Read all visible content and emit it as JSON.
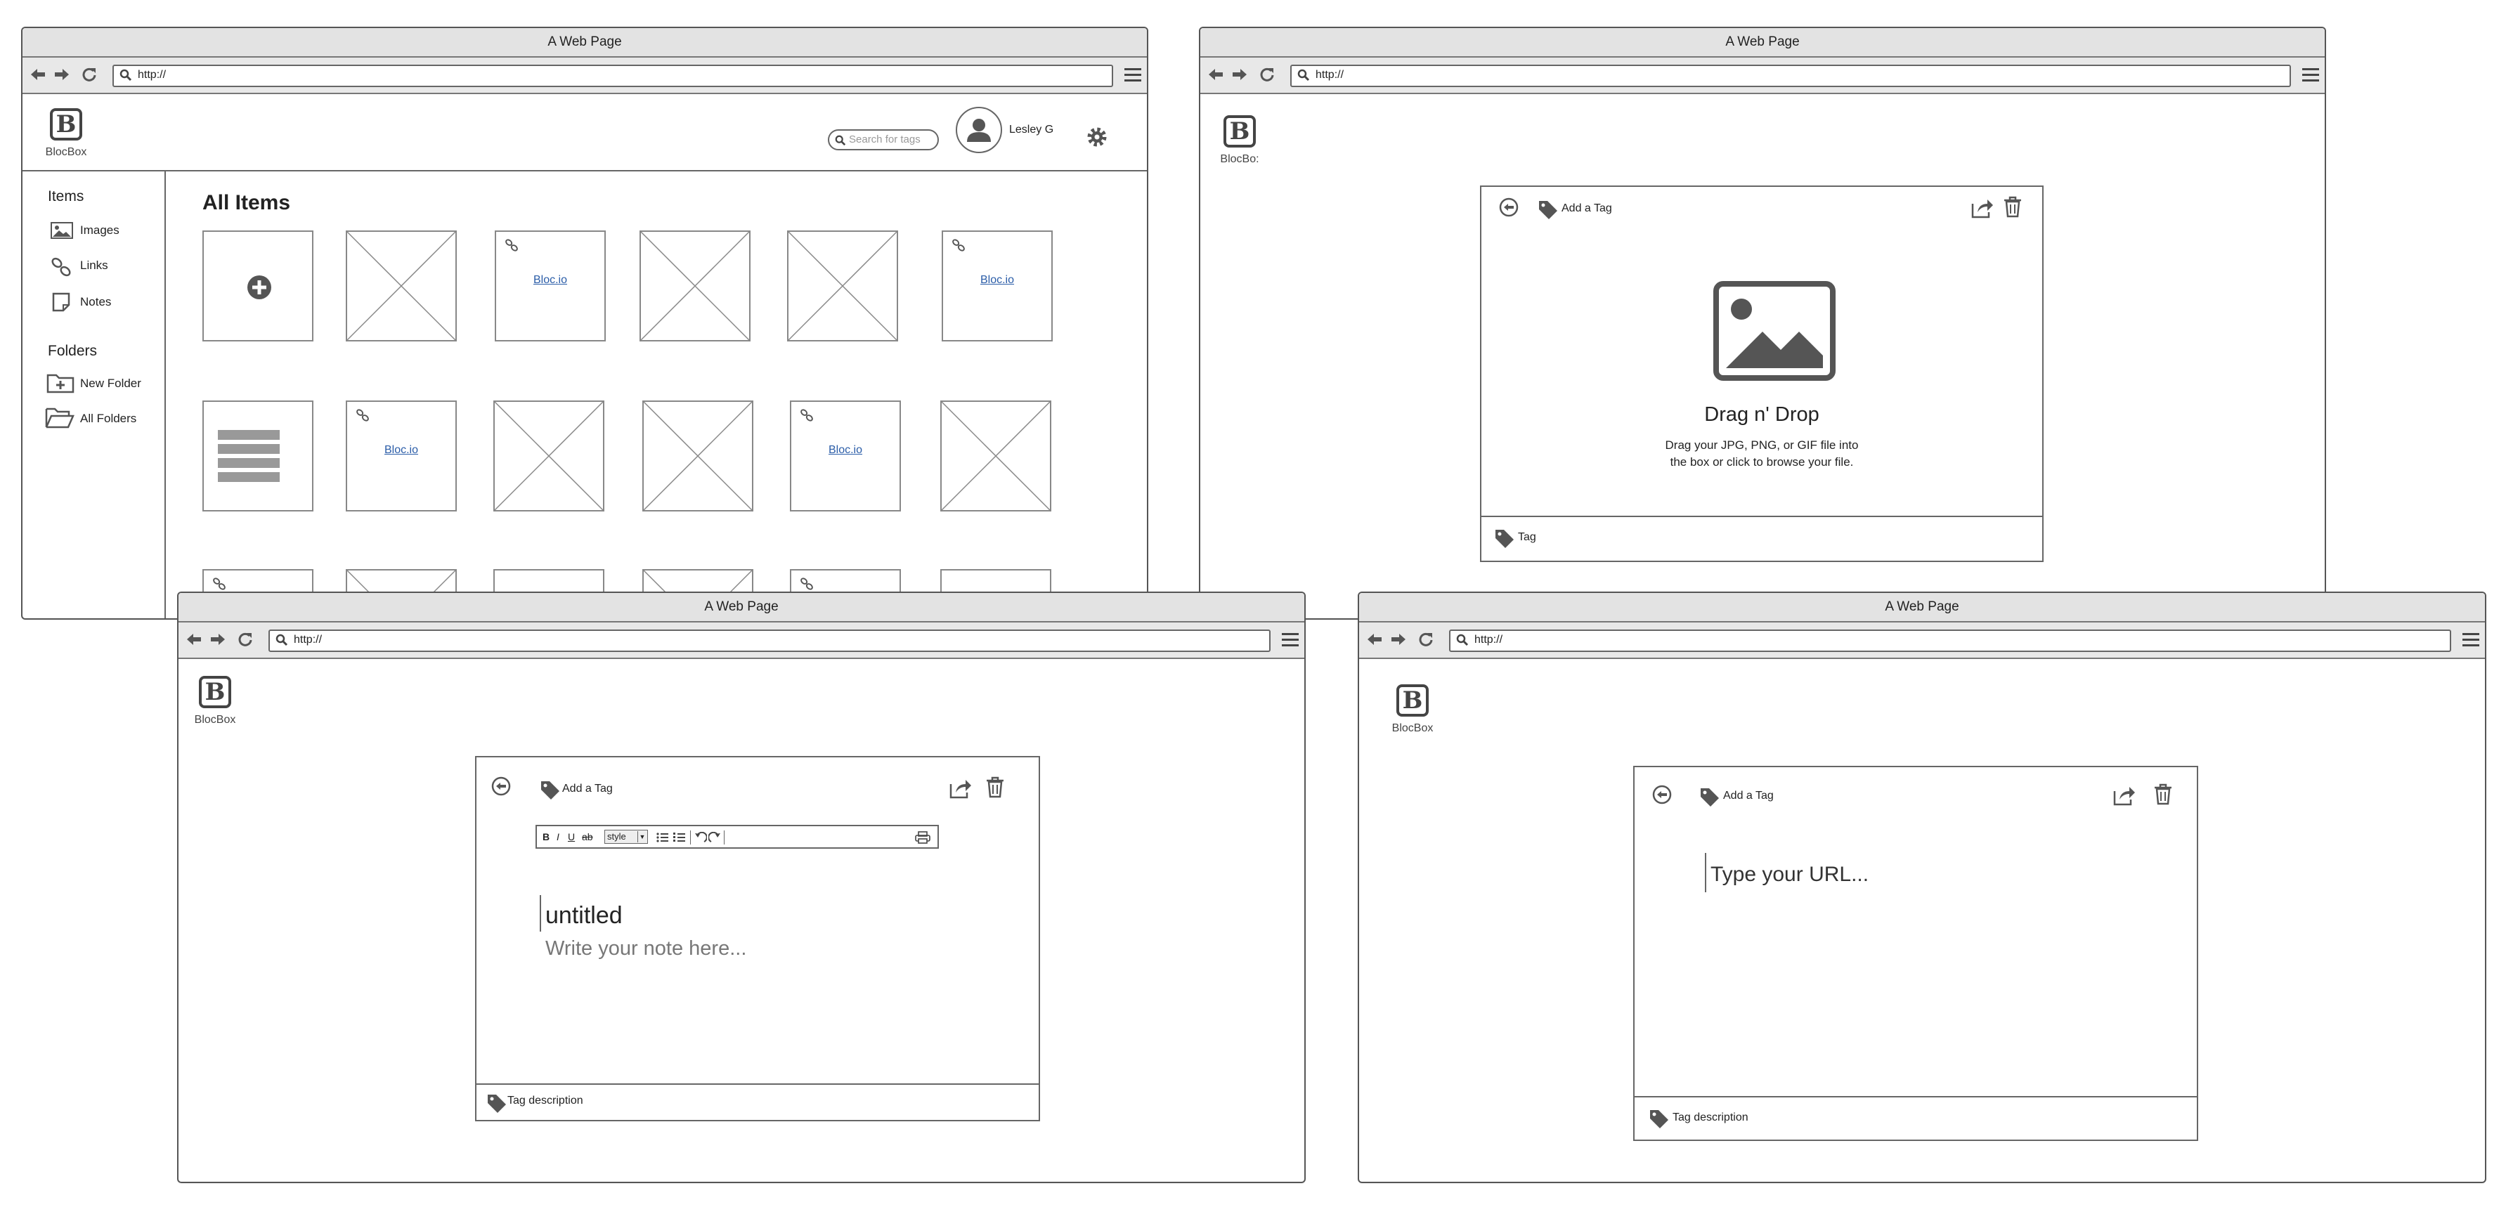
{
  "browser": {
    "title": "A Web Page",
    "url": "http://"
  },
  "brand": {
    "name": "BlocBox",
    "name_truncated": "BlocBo:"
  },
  "dashboard": {
    "search_placeholder": "Search for tags",
    "user_name": "Lesley G",
    "sidebar": {
      "items_heading": "Items",
      "items": [
        {
          "label": "Images"
        },
        {
          "label": "Links"
        },
        {
          "label": "Notes"
        }
      ],
      "folders_heading": "Folders",
      "folders": [
        {
          "label": "New Folder"
        },
        {
          "label": "All Folders"
        }
      ]
    },
    "main_title": "All Items",
    "link_text": "Bloc.io"
  },
  "image_upload": {
    "add_tag": "Add a Tag",
    "heading": "Drag n' Drop",
    "desc_line1": "Drag your JPG, PNG, or GIF file into",
    "desc_line2": "the box or click to browse your file.",
    "tag_label": "Tag"
  },
  "note_editor": {
    "add_tag": "Add a Tag",
    "style_label": "style",
    "title_value": "untitled",
    "body_placeholder": "Write your note here...",
    "tag_description": "Tag description"
  },
  "link_editor": {
    "add_tag": "Add a Tag",
    "url_placeholder": "Type your URL...",
    "tag_description": "Tag description"
  },
  "icons": [
    "back-arrow-icon",
    "forward-arrow-icon",
    "reload-icon",
    "search-icon",
    "menu-icon",
    "user-avatar-icon",
    "gear-icon",
    "image-icon",
    "link-icon",
    "note-icon",
    "new-folder-icon",
    "folder-icon",
    "plus-circle-icon",
    "back-circle-icon",
    "tag-icon",
    "share-icon",
    "trash-icon",
    "photo-placeholder-icon"
  ],
  "colors": {
    "link": "#2b5da8",
    "chrome": "#e3e3e3",
    "border": "#555555"
  }
}
